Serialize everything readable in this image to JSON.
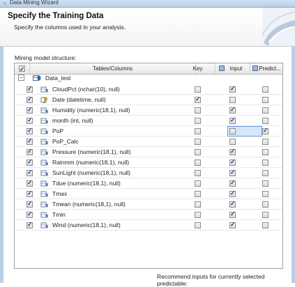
{
  "window": {
    "title": "Data Mining Wizard"
  },
  "header": {
    "title": "Specify the Training Data",
    "subtitle": "Specify the columns used in your analysis."
  },
  "section_label": "Mining model structure:",
  "columns": {
    "tables": "Tables/Columns",
    "key": "Key",
    "input": "Input",
    "predict": "Predict..."
  },
  "table": {
    "name": "Data_test"
  },
  "rows": [
    {
      "name": "CloudPct (nchar(10), null)",
      "icon": "column-icon",
      "key": false,
      "input": true,
      "predict": false
    },
    {
      "name": "Date (datetime, null)",
      "icon": "key-icon",
      "key": true,
      "input": false,
      "predict": false
    },
    {
      "name": "Humidity (numeric(18,1), null)",
      "icon": "column-icon",
      "key": false,
      "input": true,
      "predict": false
    },
    {
      "name": "month (int, null)",
      "icon": "column-icon",
      "key": false,
      "input": true,
      "predict": false
    },
    {
      "name": "PoP",
      "icon": "column-icon",
      "key": false,
      "input": false,
      "predict": true,
      "selected": true
    },
    {
      "name": "PoP_Calc",
      "icon": "column-icon",
      "key": false,
      "input": false,
      "predict": false
    },
    {
      "name": "Pressure (numeric(18,1), null)",
      "icon": "column-icon",
      "key": false,
      "input": true,
      "predict": false
    },
    {
      "name": "Rainmm (numeric(18,1), null)",
      "icon": "column-icon",
      "key": false,
      "input": true,
      "predict": false
    },
    {
      "name": "SunLight (numeric(18,1), null)",
      "icon": "column-icon",
      "key": false,
      "input": true,
      "predict": false
    },
    {
      "name": "Tdue (numeric(18,1), null)",
      "icon": "column-icon",
      "key": false,
      "input": true,
      "predict": false
    },
    {
      "name": "Tmax",
      "icon": "column-icon",
      "key": false,
      "input": true,
      "predict": false
    },
    {
      "name": "Tmean (numeric(18,1), null)",
      "icon": "column-icon",
      "key": false,
      "input": true,
      "predict": false
    },
    {
      "name": "Tmin",
      "icon": "column-icon",
      "key": false,
      "input": true,
      "predict": false
    },
    {
      "name": "Wind (numeric(18,1), null)",
      "icon": "column-icon",
      "key": false,
      "input": true,
      "predict": false
    }
  ],
  "footer": {
    "recommend_label": "Recommend inputs for currently selected predictable:"
  },
  "colors": {
    "accent": "#1b3f88",
    "selection": "#d6e6fb",
    "titlebar": "#b9cfe8"
  }
}
